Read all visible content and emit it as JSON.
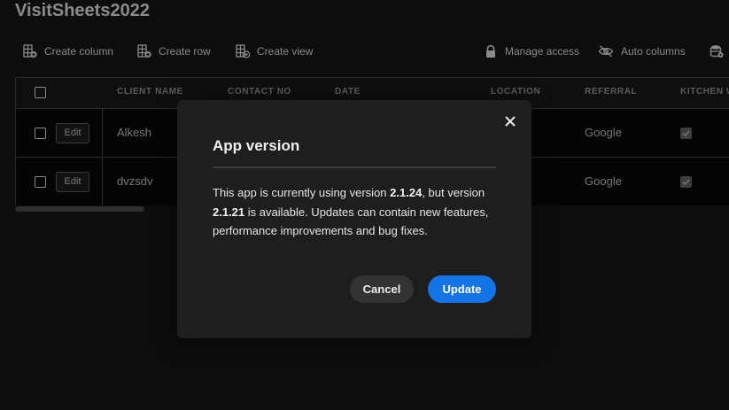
{
  "app": {
    "title": "VisitSheets2022"
  },
  "toolbar": {
    "create_column": "Create column",
    "create_row": "Create row",
    "create_view": "Create view",
    "manage_access": "Manage access",
    "auto_columns": "Auto columns"
  },
  "grid": {
    "columns": [
      "CLIENT NAME",
      "CONTACT NO",
      "DATE",
      "LOCATION",
      "REFERRAL",
      "KITCHEN W"
    ],
    "rows": [
      {
        "edit_label": "Edit",
        "client_name": "Alkesh",
        "referral": "Google",
        "kitchen_checked": true
      },
      {
        "edit_label": "Edit",
        "client_name": "dvzsdv",
        "referral": "Google",
        "kitchen_checked": true
      }
    ]
  },
  "modal": {
    "title": "App version",
    "body_1": "This app is currently using version ",
    "current_version": "2.1.24",
    "body_2": ", but version ",
    "available_version": "2.1.21",
    "body_3": " is available. Updates can contain new features, performance improvements and bug fixes.",
    "cancel_label": "Cancel",
    "update_label": "Update"
  },
  "colors": {
    "accent": "#1473e6",
    "modal_bg": "#1e1e1e",
    "page_bg": "#0d0d0d"
  }
}
